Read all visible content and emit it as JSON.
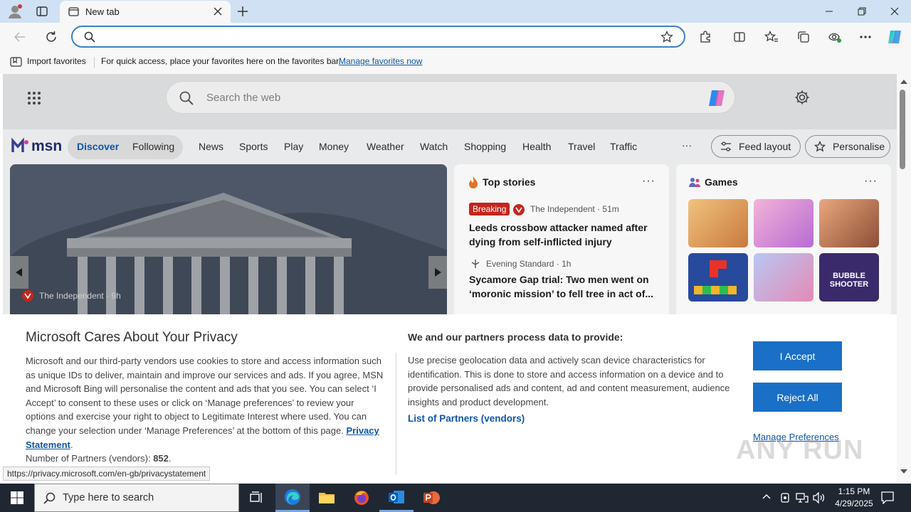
{
  "browser": {
    "tab_title": "New tab",
    "favorites_bar": {
      "import_label": "Import favorites",
      "hint_text": "For quick access, place your favorites here on the favorites bar.",
      "manage_link": "Manage favorites now"
    }
  },
  "msn": {
    "search_placeholder": "Search the web",
    "logo_text": "msn",
    "tabs": [
      "Discover",
      "Following"
    ],
    "nav_items": [
      "News",
      "Sports",
      "Play",
      "Money",
      "Weather",
      "Watch",
      "Shopping",
      "Health",
      "Travel",
      "Traffic"
    ],
    "more_label": "···",
    "feed_layout_label": "Feed layout",
    "personalise_label": "Personalise",
    "hero": {
      "source": "The Independent · 9h"
    },
    "top_stories": {
      "title": "Top stories",
      "items": [
        {
          "badge": "Breaking",
          "source": "The Independent · 51m",
          "headline": "Leeds crossbow attacker named after dying from self-inflicted injury"
        },
        {
          "source": "Evening Standard · 1h",
          "headline": "Sycamore Gap trial: Two men went on ‘moronic mission’ to fell tree in act of..."
        }
      ]
    },
    "games": {
      "title": "Games",
      "tile_text": "BUBBLE SHOOTER"
    }
  },
  "privacy": {
    "title": "Microsoft Cares About Your Privacy",
    "body": "Microsoft and our third-party vendors use cookies to store and access information such as unique IDs to deliver, maintain and improve our services and ads. If you agree, MSN and Microsoft Bing will personalise the content and ads that you see. You can select ‘I Accept’ to consent to these uses or click on ‘Manage preferences’ to review your options and exercise your right to object to Legitimate Interest where used.  You can change your selection under ‘Manage Preferences’ at the bottom of this page.",
    "statement_link": "Privacy Statement",
    "partners_label": "Number of Partners (vendors): ",
    "partners_count": "852",
    "right_title": "We and our partners process data to provide:",
    "right_body": "Use precise geolocation data and actively scan device characteristics for identification. This is done to store and access information on a device and to provide personalised ads and content, ad and content measurement, audience insights and product development.",
    "vendors_link": "List of Partners (vendors)",
    "accept_label": "I Accept",
    "reject_label": "Reject All",
    "manage_label": "Manage Preferences"
  },
  "status_url": "https://privacy.microsoft.com/en-gb/privacystatement",
  "taskbar": {
    "search_placeholder": "Type here to search",
    "time": "1:15 PM",
    "date": "4/29/2025"
  },
  "watermark": "ANY RUN"
}
